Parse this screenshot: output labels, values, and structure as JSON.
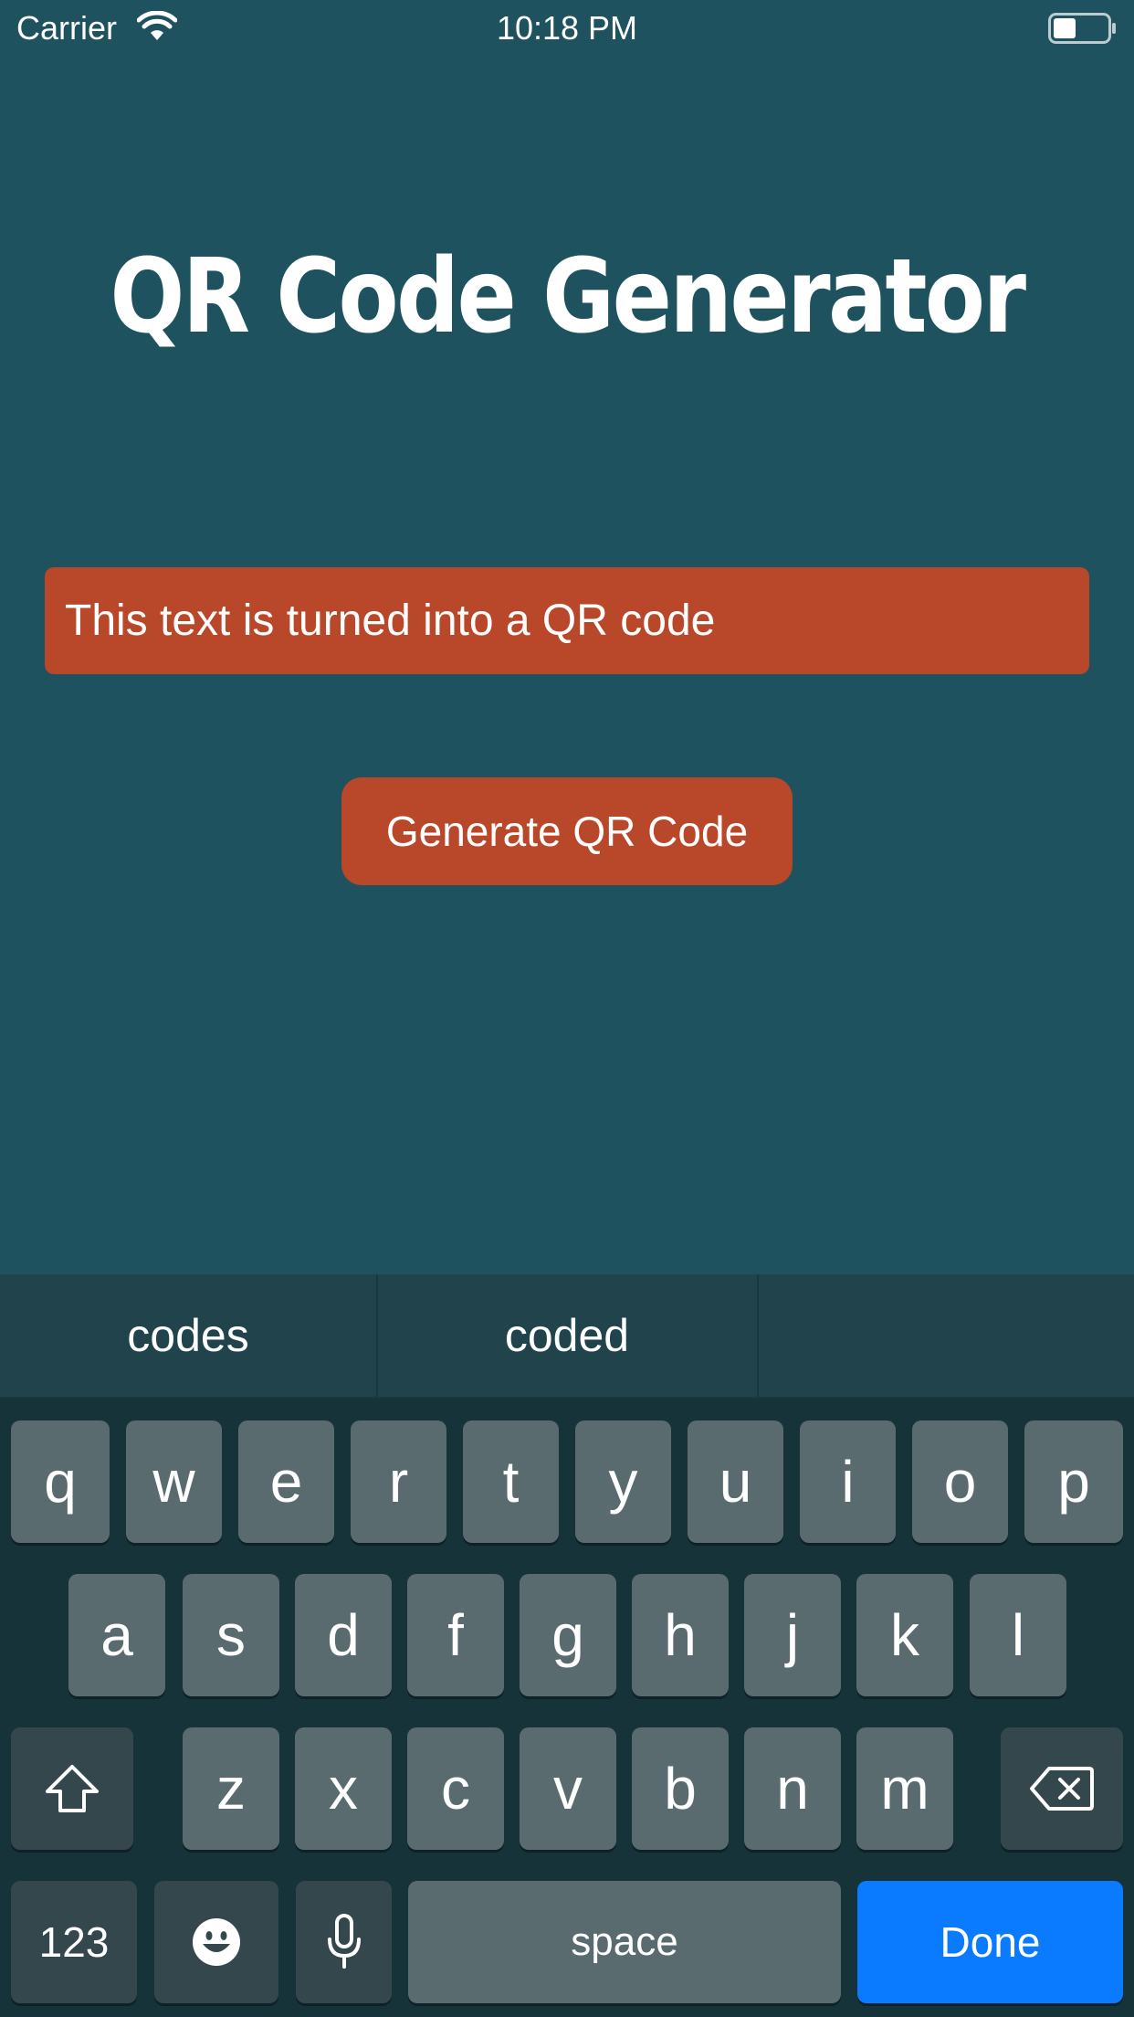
{
  "status_bar": {
    "carrier": "Carrier",
    "time": "10:18 PM",
    "icons": [
      "wifi-icon",
      "battery-icon"
    ]
  },
  "title": "QR Code Generator",
  "input": {
    "value": "This text is turned into a QR code"
  },
  "button": {
    "label": "Generate QR Code"
  },
  "colors": {
    "background": "#1d525e",
    "accent": "#b9472a",
    "done_key": "#0a7aff"
  },
  "keyboard": {
    "suggestions": [
      "codes",
      "coded",
      ""
    ],
    "row1": [
      "q",
      "w",
      "e",
      "r",
      "t",
      "y",
      "u",
      "i",
      "o",
      "p"
    ],
    "row2": [
      "a",
      "s",
      "d",
      "f",
      "g",
      "h",
      "j",
      "k",
      "l"
    ],
    "row3": [
      "z",
      "x",
      "c",
      "v",
      "b",
      "n",
      "m"
    ],
    "numbers_key": "123",
    "space_key": "space",
    "done_key": "Done",
    "icons": [
      "shift-icon",
      "backspace-icon",
      "emoji-icon",
      "microphone-icon"
    ]
  }
}
